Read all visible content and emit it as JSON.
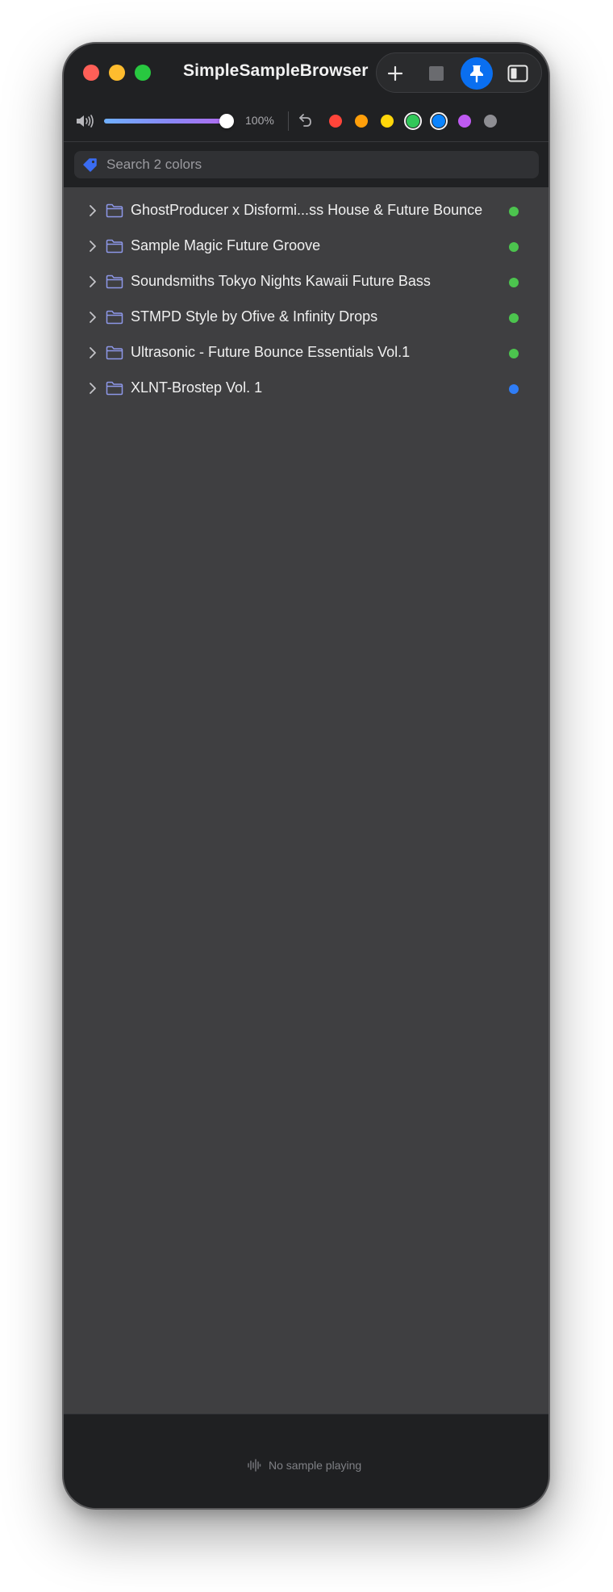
{
  "window": {
    "title": "SimpleSampleBrowser"
  },
  "toolbar": {
    "add_icon": "plus-icon",
    "stop_icon": "stop-square-icon",
    "pin_icon": "pin-icon",
    "sidebar_icon": "sidebar-toggle-icon",
    "pin_active_color": "#0a6ff0"
  },
  "volume": {
    "icon": "speaker-icon",
    "level": 1.0,
    "percent_label": "100%"
  },
  "filters": {
    "undo_icon": "undo-arrow-icon",
    "colors": [
      {
        "name": "red",
        "hex": "#ff453a",
        "selected": false
      },
      {
        "name": "orange",
        "hex": "#ff9f0a",
        "selected": false
      },
      {
        "name": "yellow",
        "hex": "#ffd60a",
        "selected": false
      },
      {
        "name": "green",
        "hex": "#32c759",
        "selected": true
      },
      {
        "name": "blue",
        "hex": "#0a84ff",
        "selected": true
      },
      {
        "name": "purple",
        "hex": "#bf5af2",
        "selected": false
      },
      {
        "name": "gray",
        "hex": "#8e8e93",
        "selected": false
      }
    ]
  },
  "search": {
    "icon": "tag-icon",
    "placeholder": "Search 2 colors",
    "value": ""
  },
  "list": {
    "items": [
      {
        "name": "GhostProducer x Disformi...ss House & Future Bounce",
        "dot_color": "#4cc44e"
      },
      {
        "name": "Sample Magic Future Groove",
        "dot_color": "#4cc44e"
      },
      {
        "name": "Soundsmiths Tokyo Nights Kawaii Future Bass",
        "dot_color": "#4cc44e"
      },
      {
        "name": "STMPD Style by Ofive & Infinity Drops",
        "dot_color": "#4cc44e"
      },
      {
        "name": "Ultrasonic - Future Bounce Essentials Vol.1",
        "dot_color": "#4cc44e"
      },
      {
        "name": "XLNT-Brostep Vol. 1",
        "dot_color": "#2f7df6"
      }
    ]
  },
  "footer": {
    "icon": "waveform-icon",
    "status": "No sample playing"
  }
}
